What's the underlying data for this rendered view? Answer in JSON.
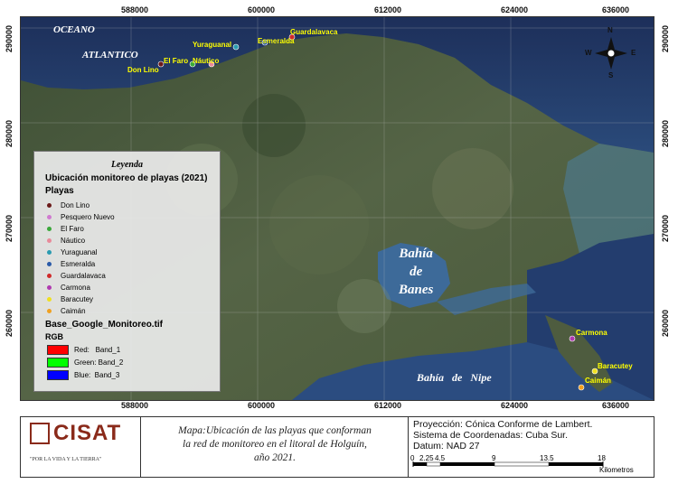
{
  "map": {
    "x_ticks": [
      "588000",
      "600000",
      "612000",
      "624000",
      "636000"
    ],
    "y_ticks": [
      "290000",
      "280000",
      "270000",
      "260000"
    ],
    "ocean_label_1": "OCEANO",
    "ocean_label_2": "ATLANTICO",
    "bay_1": "Bahía",
    "bay_2": "de",
    "bay_3": "Banes",
    "bay_nipe": "Bahía   de   Nipe",
    "places": {
      "don_lino": "Don Lino",
      "el_faro": "El Faro",
      "nautico": "Náutico",
      "yuraguanal": "Yuraguanal",
      "esmeralda": "Esmeralda",
      "guardalavaca": "Guardalavaca",
      "carmona": "Carmona",
      "baracutey": "Baracutey",
      "caiman": "Caimán"
    },
    "compass": {
      "n": "N",
      "s": "S",
      "e": "E",
      "w": "W"
    }
  },
  "legend": {
    "title": "Leyenda",
    "subtitle": "Ubicación monitoreo de playas (2021)",
    "group": "Playas",
    "items": [
      {
        "label": "Don Lino",
        "color": "#6b1a1a"
      },
      {
        "label": "Pesquero Nuevo",
        "color": "#d07ad0"
      },
      {
        "label": "El Faro",
        "color": "#3aa83a"
      },
      {
        "label": "Náutico",
        "color": "#e88a9a"
      },
      {
        "label": "Yuraguanal",
        "color": "#2a9bb0"
      },
      {
        "label": "Esmeralda",
        "color": "#2a5aa8"
      },
      {
        "label": "Guardalavaca",
        "color": "#d02a2a"
      },
      {
        "label": "Carmona",
        "color": "#b03ab0"
      },
      {
        "label": "Baracutey",
        "color": "#f0e020"
      },
      {
        "label": "Caimán",
        "color": "#f0a020"
      }
    ],
    "raster": "Base_Google_Monitoreo.tif",
    "rgb": "RGB",
    "bands": [
      {
        "label": "Red:   Band_1",
        "color": "#ff0000"
      },
      {
        "label": "Green: Band_2",
        "color": "#00ff00"
      },
      {
        "label": "Blue:  Band_3",
        "color": "#0000ff"
      }
    ]
  },
  "footer": {
    "logo_text": "CISAT",
    "logo_motto": "\"POR LA VIDA Y LA TIERRA\"",
    "caption_1": "Mapa:Ubicación de las playas que conforman",
    "caption_2": "la red de monitoreo en el litoral de Holguín,",
    "caption_3": "año 2021.",
    "proj_1": "Proyección: Cónica Conforme de Lambert.",
    "proj_2": "Sistema de Coordenadas: Cuba Sur.",
    "proj_3": "Datum: NAD 27",
    "scale_ticks": [
      "0",
      "2.25",
      "4.5",
      "9",
      "13.5",
      "18"
    ],
    "scale_unit": "Kilometros"
  }
}
